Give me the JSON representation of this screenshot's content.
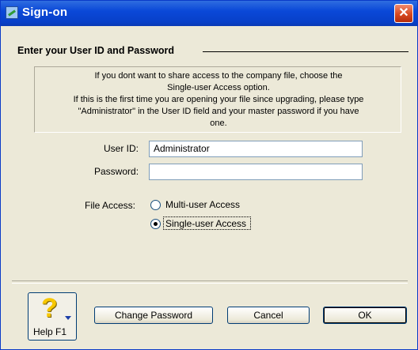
{
  "window": {
    "title": "Sign-on",
    "close_glyph": "✕"
  },
  "group": {
    "title": "Enter your User ID and Password"
  },
  "info": {
    "line1": "If you dont want to share access to the company file, choose the",
    "line2": "Single-user Access option.",
    "line3": "If this is the first time you are opening your file since upgrading, please type",
    "line4": "\"Administrator\" in the User ID field and your master password if you have",
    "line5": "one."
  },
  "form": {
    "user_id_label": "User ID:",
    "user_id_value": "Administrator",
    "password_label": "Password:",
    "password_value": "",
    "file_access_label": "File Access:",
    "file_access_options": [
      {
        "label": "Multi-user Access",
        "selected": false
      },
      {
        "label": "Single-user Access",
        "selected": true
      }
    ]
  },
  "buttons": {
    "help_glyph": "?",
    "help_label": "Help F1",
    "change_password": "Change Password",
    "cancel": "Cancel",
    "ok": "OK"
  },
  "icons": {
    "app": "qb-app-icon",
    "close": "close-icon",
    "help": "help-question-icon"
  },
  "colors": {
    "titlebar": "#0a48d8",
    "dialog_bg": "#ece9d8",
    "close_button": "#d7481f"
  }
}
